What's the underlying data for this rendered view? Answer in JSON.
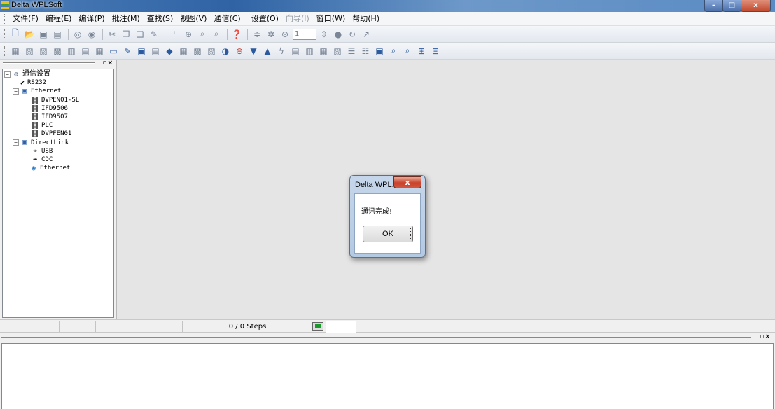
{
  "window": {
    "title": "Delta WPLSoft",
    "controls": {
      "minimize": "–",
      "maximize": "□",
      "close": "x"
    }
  },
  "menu": {
    "items": [
      {
        "label": "文件(F)",
        "enabled": true
      },
      {
        "label": "编程(E)",
        "enabled": true
      },
      {
        "label": "编译(P)",
        "enabled": true
      },
      {
        "label": "批注(M)",
        "enabled": true
      },
      {
        "label": "查找(S)",
        "enabled": true
      },
      {
        "label": "视图(V)",
        "enabled": true
      },
      {
        "label": "通信(C)",
        "enabled": true
      },
      {
        "label": "设置(O)",
        "enabled": true
      },
      {
        "label": "向导(I)",
        "enabled": false
      },
      {
        "label": "窗口(W)",
        "enabled": true
      },
      {
        "label": "帮助(H)",
        "enabled": true
      }
    ]
  },
  "toolbar1": {
    "step_value": "1"
  },
  "panel": {
    "buttons": "▫×"
  },
  "tree": {
    "root": {
      "label": "通信设置",
      "expander": "−"
    },
    "rs232": {
      "label": "RS232",
      "check": "✔"
    },
    "ethernet": {
      "label": "Ethernet",
      "expander": "−",
      "devices": [
        "DVPEN01-SL",
        "IFD9506",
        "IFD9507",
        "PLC",
        "DVPFEN01"
      ]
    },
    "directlink": {
      "label": "DirectLink",
      "expander": "−",
      "children": [
        "USB",
        "CDC",
        "Ethernet"
      ]
    }
  },
  "status": {
    "steps": "0 / 0 Steps",
    "led_color": "#1a9a2a"
  },
  "dialog": {
    "title": "Delta WPL...",
    "close": "x",
    "message": "通讯完成!",
    "ok_label": "OK"
  }
}
